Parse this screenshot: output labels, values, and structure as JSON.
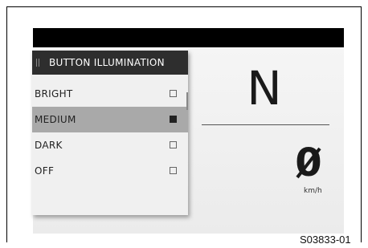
{
  "menu": {
    "title": "BUTTON ILLUMINATION",
    "items": [
      {
        "label": "BRIGHT",
        "checked": false,
        "selected": false
      },
      {
        "label": "MEDIUM",
        "checked": true,
        "selected": true
      },
      {
        "label": "DARK",
        "checked": false,
        "selected": false
      },
      {
        "label": "OFF",
        "checked": false,
        "selected": false
      }
    ]
  },
  "dashboard": {
    "gear": "N",
    "speed_value": "0",
    "speed_unit": "km/h"
  },
  "figure_id": "S03833-01",
  "colors": {
    "header_bg": "#2e2e2e",
    "selected_bg": "#a9a9a9",
    "screen_bg": "#efefef",
    "top_bar": "#000000"
  },
  "icons": {
    "grip": "drag-handle-icon",
    "checkbox": "checkbox-icon"
  }
}
